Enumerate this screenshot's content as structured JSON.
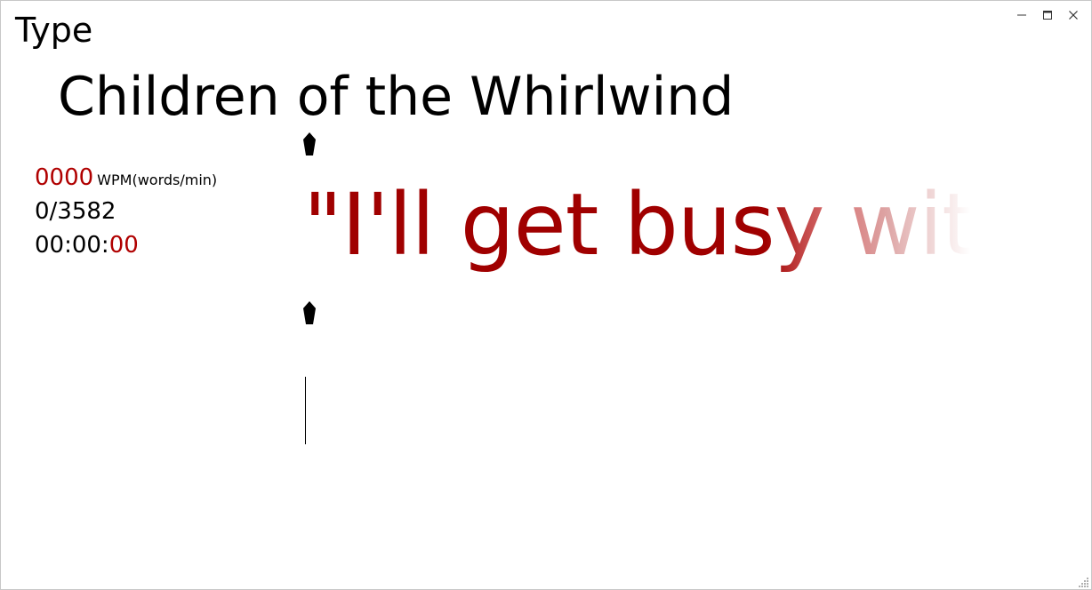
{
  "app": {
    "title": "Type"
  },
  "window_controls": {
    "minimize_icon": "minimize-icon",
    "maximize_icon": "maximize-icon",
    "close_icon": "close-icon"
  },
  "document": {
    "title": "Children of the Whirlwind"
  },
  "stats": {
    "wpm_value": "0000",
    "wpm_unit": "WPM(words/min)",
    "progress": "0/3582",
    "timer_prefix": "00:00:",
    "timer_seconds": "00"
  },
  "passage": {
    "visible_text": "\"I'll get busy with"
  },
  "colors": {
    "accent_red": "#b00000",
    "passage_red": "#a00000",
    "background": "#ffffff"
  }
}
